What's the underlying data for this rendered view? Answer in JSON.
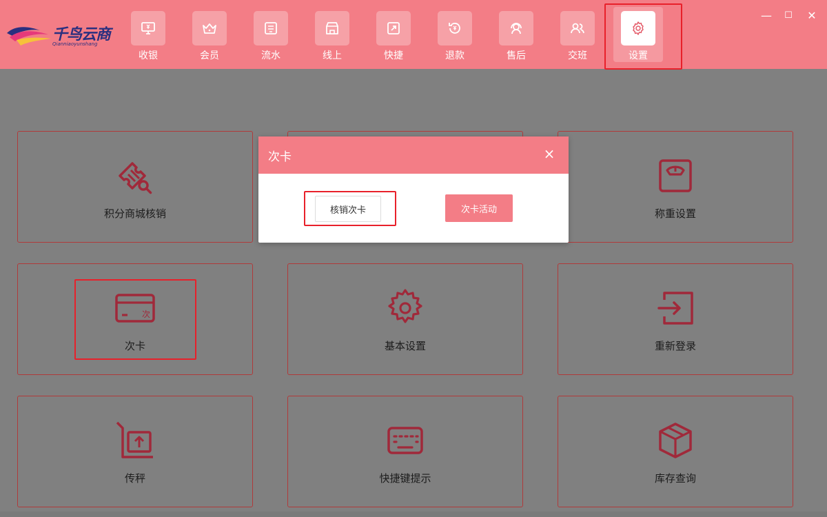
{
  "brand": {
    "name": "千鸟云商",
    "tagline": "Qianniaoyunshang"
  },
  "nav": {
    "items": [
      {
        "label": "收银",
        "icon": "cashier-monitor-icon"
      },
      {
        "label": "会员",
        "icon": "crown-icon"
      },
      {
        "label": "流水",
        "icon": "ledger-icon"
      },
      {
        "label": "线上",
        "icon": "store-icon"
      },
      {
        "label": "快捷",
        "icon": "shortcut-icon"
      },
      {
        "label": "退款",
        "icon": "refund-icon"
      },
      {
        "label": "售后",
        "icon": "headset-icon"
      },
      {
        "label": "交班",
        "icon": "users-icon"
      },
      {
        "label": "设置",
        "icon": "gear-icon",
        "active": true
      }
    ]
  },
  "window_controls": {
    "minimize": "—",
    "maximize": "☐",
    "close": "✕"
  },
  "tiles": [
    {
      "label": "积分商城核销",
      "icon": "ticket-search-icon"
    },
    {
      "label": "",
      "icon": ""
    },
    {
      "label": "称重设置",
      "icon": "scale-icon"
    },
    {
      "label": "次卡",
      "icon": "punch-card-icon",
      "card_text": "次"
    },
    {
      "label": "基本设置",
      "icon": "gear-icon"
    },
    {
      "label": "重新登录",
      "icon": "login-icon"
    },
    {
      "label": "传秤",
      "icon": "scale-upload-icon"
    },
    {
      "label": "快捷键提示",
      "icon": "keyboard-icon"
    },
    {
      "label": "库存查询",
      "icon": "box-icon"
    }
  ],
  "modal": {
    "title": "次卡",
    "close": "×",
    "buttons": {
      "redeem": "核销次卡",
      "activity": "次卡活动"
    }
  },
  "colors": {
    "primary": "#f37d86",
    "icon": "#a0293a",
    "highlight": "#e8202a"
  }
}
